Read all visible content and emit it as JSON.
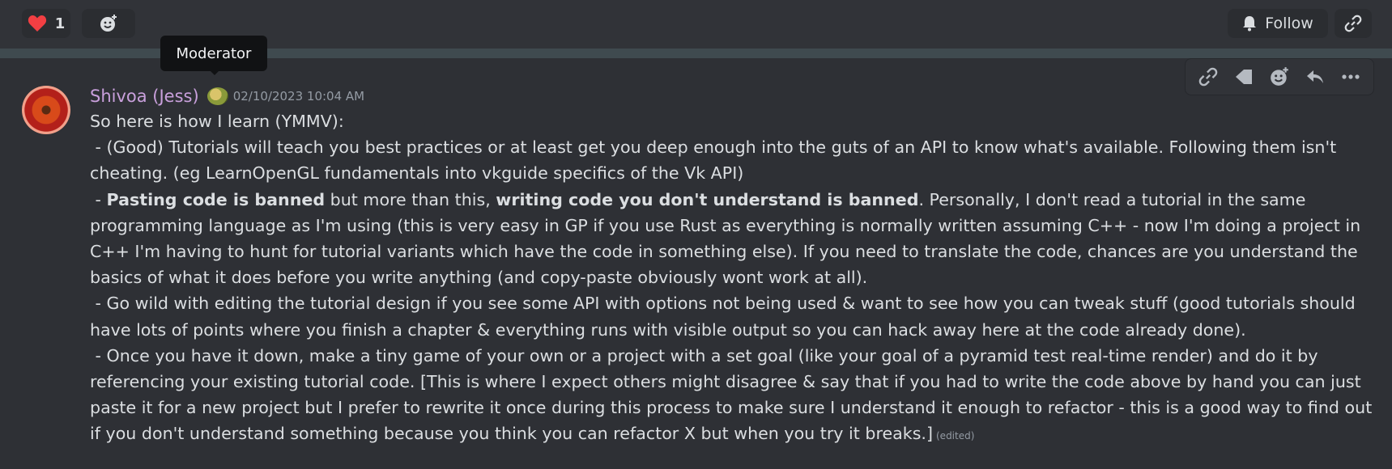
{
  "reactions": [
    {
      "emoji": "heart",
      "count": "1"
    }
  ],
  "toolbar_top": {
    "follow_label": "Follow"
  },
  "tooltip": {
    "text": "Moderator"
  },
  "message": {
    "author": "Shivoa (Jess)",
    "timestamp": "02/10/2023 10:04 AM",
    "lines": {
      "intro": "So here is how I learn (YMMV):",
      "p1": " - (Good) Tutorials will teach you best practices or at least get you deep enough into the guts of an API to know what's available. Following them isn't cheating. (eg LearnOpenGL fundamentals into vkguide specifics of the Vk API)",
      "p2_a": " - ",
      "p2_bold1": "Pasting code is banned",
      "p2_b": " but more than this, ",
      "p2_bold2": "writing code you don't understand is banned",
      "p2_c": ". Personally, I don't read a tutorial in the same programming language as I'm using (this is very easy in GP if you use Rust as everything is normally written assuming C++ - now I'm doing a project in C++ I'm having to hunt for tutorial variants which have the code in something else). If you need to translate the code, chances are you understand the basics of what it does before you write anything (and copy-paste obviously wont work at all).",
      "p3": " - Go wild with editing the tutorial design if you see some API with options not being used & want to see how you can tweak stuff (good tutorials should have lots of points where you finish a chapter & everything runs with visible output so you can hack away here at the code already done).",
      "p4": " - Once you have it down, make a tiny game of your own or a project with a set goal (like your goal of a pyramid test real-time render) and do it by referencing your existing tutorial code. [This is where I expect others might disagree & say that if you had to write the code above by hand you can just paste it for a new project but I prefer to rewrite it once during this process to make sure I understand it enough to refactor - this is a good way to find out if you don't understand something because you think you can refactor X but when you try it breaks.]"
    },
    "edited_label": "(edited)"
  },
  "colors": {
    "background": "#313338",
    "message_hover": "#2e3035",
    "username": "#c9a0dc",
    "heart": "#f23f43"
  },
  "icons": [
    "heart-icon",
    "add-reaction-icon",
    "bell-icon",
    "link-icon",
    "forward-icon",
    "reply-icon",
    "more-icon"
  ]
}
